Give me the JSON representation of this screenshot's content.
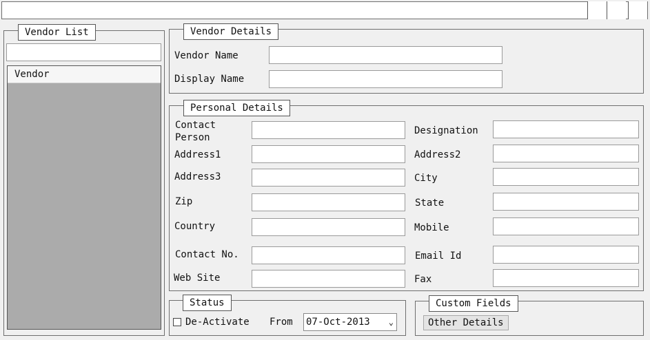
{
  "vendor_list": {
    "title": "Vendor List",
    "search_value": "",
    "column_header": "Vendor",
    "rows": []
  },
  "vendor_details": {
    "title": "Vendor Details",
    "vendor_name_label": "Vendor Name",
    "vendor_name_value": "",
    "display_name_label": "Display Name",
    "display_name_value": ""
  },
  "personal_details": {
    "title": "Personal Details",
    "contact_person_label": "Contact Person",
    "designation_label": "Designation",
    "address1_label": "Address1",
    "address2_label": "Address2",
    "address3_label": "Address3",
    "city_label": "City",
    "zip_label": "Zip",
    "state_label": "State",
    "country_label": "Country",
    "mobile_label": "Mobile",
    "contact_no_label": "Contact No.",
    "email_label": "Email Id",
    "website_label": "Web Site",
    "fax_label": "Fax"
  },
  "status": {
    "title": "Status",
    "deactivate_label": "De-Activate",
    "deactivate_checked": false,
    "from_label": "From",
    "from_date": "07-Oct-2013"
  },
  "custom_fields": {
    "title": "Custom Fields",
    "other_details_label": "Other Details"
  },
  "colors": {
    "background": "#f0f0f0",
    "grid_empty": "#ababab",
    "input_bg": "#ffffff"
  }
}
